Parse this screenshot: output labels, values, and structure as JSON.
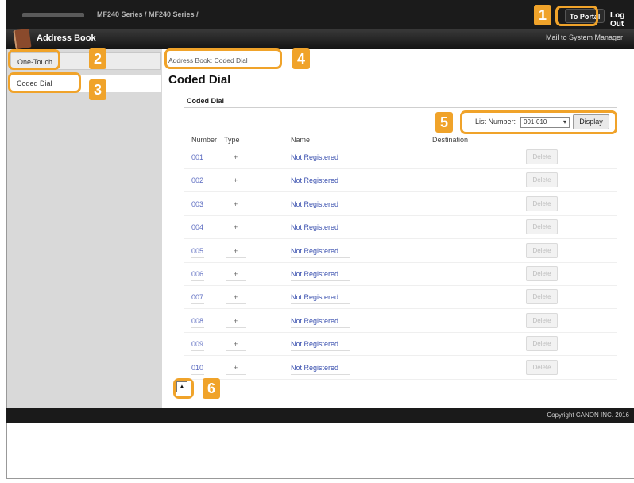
{
  "header": {
    "model_text": "MF240 Series / MF240 Series /",
    "portal_label": "To Portal",
    "logout_label": "Log Out",
    "mail_label": "Mail to System Manager",
    "app_title": "Address Book",
    "accent_color": "#f0a32a"
  },
  "sidebar": {
    "items": [
      {
        "label": "One-Touch"
      },
      {
        "label": "Coded Dial"
      }
    ]
  },
  "main": {
    "breadcrumb": "Address Book: Coded Dial",
    "page_title": "Coded Dial",
    "section_title": "Coded Dial",
    "list_number_label": "List Number:",
    "list_number_value": "001-010",
    "display_label": "Display",
    "columns": [
      "Number",
      "Type",
      "Name",
      "Destination"
    ],
    "rows": [
      {
        "number": "001",
        "type": "+",
        "name": "Not Registered",
        "delete": "Delete"
      },
      {
        "number": "002",
        "type": "+",
        "name": "Not Registered",
        "delete": "Delete"
      },
      {
        "number": "003",
        "type": "+",
        "name": "Not Registered",
        "delete": "Delete"
      },
      {
        "number": "004",
        "type": "+",
        "name": "Not Registered",
        "delete": "Delete"
      },
      {
        "number": "005",
        "type": "+",
        "name": "Not Registered",
        "delete": "Delete"
      },
      {
        "number": "006",
        "type": "+",
        "name": "Not Registered",
        "delete": "Delete"
      },
      {
        "number": "007",
        "type": "+",
        "name": "Not Registered",
        "delete": "Delete"
      },
      {
        "number": "008",
        "type": "+",
        "name": "Not Registered",
        "delete": "Delete"
      },
      {
        "number": "009",
        "type": "+",
        "name": "Not Registered",
        "delete": "Delete"
      },
      {
        "number": "010",
        "type": "+",
        "name": "Not Registered",
        "delete": "Delete"
      }
    ],
    "to_top_glyph": "▲"
  },
  "footer": {
    "copyright": "Copyright CANON INC. 2016"
  },
  "callouts": [
    "1",
    "2",
    "3",
    "4",
    "5",
    "6"
  ]
}
